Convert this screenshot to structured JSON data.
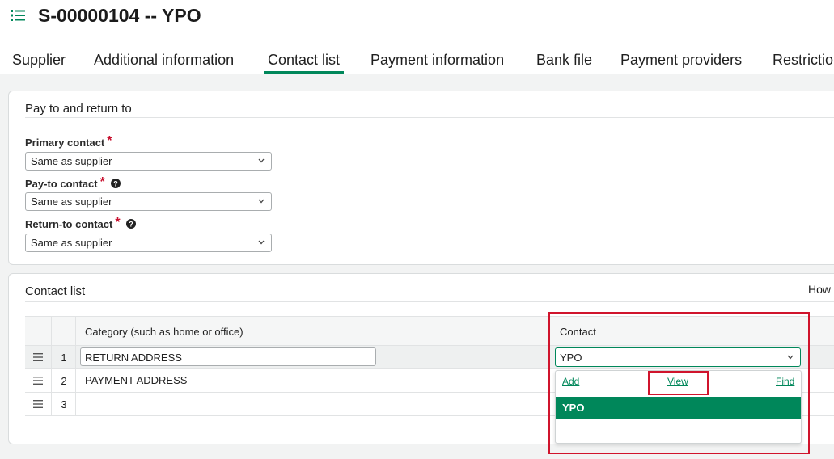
{
  "header": {
    "title": "S-00000104 -- YPO",
    "menu_icon": "list-icon"
  },
  "tabs": [
    {
      "label": "Supplier"
    },
    {
      "label": "Additional information"
    },
    {
      "label": "Contact list",
      "active": true
    },
    {
      "label": "Payment information"
    },
    {
      "label": "Bank file"
    },
    {
      "label": "Payment providers"
    },
    {
      "label": "Restrictio"
    }
  ],
  "pay_to_section": {
    "title": "Pay to and return to",
    "fields": [
      {
        "label": "Primary contact",
        "required": "*",
        "value": "Same as supplier",
        "has_help": false
      },
      {
        "label": "Pay-to contact",
        "required": "*",
        "value": "Same as supplier",
        "has_help": true
      },
      {
        "label": "Return-to contact",
        "required": "*",
        "value": "Same as supplier",
        "has_help": true
      }
    ]
  },
  "contact_list": {
    "title": "Contact list",
    "how_text": "How",
    "columns": {
      "category": "Category (such as home or office)",
      "contact": "Contact"
    },
    "rows": [
      {
        "num": "1",
        "category": "RETURN ADDRESS",
        "contact": "YPO"
      },
      {
        "num": "2",
        "category": "PAYMENT ADDRESS",
        "contact": ""
      },
      {
        "num": "3",
        "category": "",
        "contact": ""
      }
    ],
    "dropdown": {
      "add_label": "Add",
      "view_label": "View",
      "find_label": "Find",
      "options": [
        "YPO"
      ]
    }
  },
  "colors": {
    "accent": "#00875a",
    "highlight": "#d0142c",
    "required": "#c8102e"
  }
}
